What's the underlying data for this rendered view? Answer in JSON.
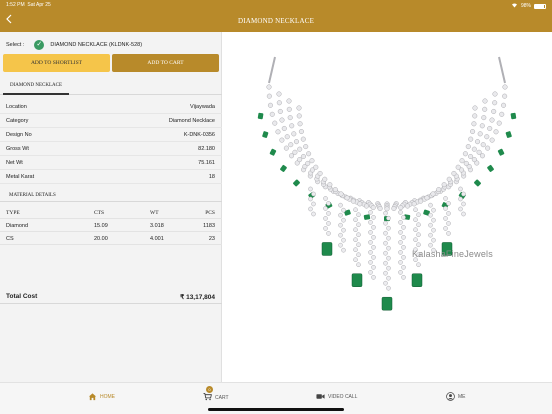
{
  "status": {
    "time": "1:52 PM",
    "date": "Sat Apr 25",
    "battery": "98%"
  },
  "header": {
    "title": "DIAMOND NECKLACE",
    "back_icon": "chevron-left-icon"
  },
  "select": {
    "label": "Select :",
    "product": "DIAMOND NECKLACE (KLDNK-528)"
  },
  "buttons": {
    "shortlist": "ADD TO SHORTLIST",
    "cart": "ADD TO CART"
  },
  "tab": {
    "label": "DIAMOND NECKLACE"
  },
  "details": [
    {
      "key": "Location",
      "value": "Vijaywada"
    },
    {
      "key": "Category",
      "value": "Diamond Necklace"
    },
    {
      "key": "Design No",
      "value": "K-DNK-0356"
    },
    {
      "key": "Gross Wt",
      "value": "82.180"
    },
    {
      "key": "Net Wt",
      "value": "75.161"
    },
    {
      "key": "Metal Karat",
      "value": "18"
    }
  ],
  "material": {
    "title": "MATERIAL DETAILS",
    "headers": [
      "TYPE",
      "CTS",
      "WT",
      "PCS"
    ],
    "rows": [
      [
        "Diamond",
        "15.09",
        "3.018",
        "1183"
      ],
      [
        "CS",
        "20.00",
        "4.001",
        "23"
      ]
    ]
  },
  "total": {
    "label": "Total Cost",
    "value": "₹ 13,17,804"
  },
  "product_image": {
    "watermark": "KalashaFineJewels"
  },
  "bottom_nav": {
    "home": "HOME",
    "cart": "CART",
    "cart_badge": "0",
    "video": "VIDEO CALL",
    "me": "ME"
  },
  "colors": {
    "brand": "#b88a2a",
    "highlight": "#f5c54a",
    "success": "#3a9a62",
    "emerald": "#1f8a4c"
  }
}
